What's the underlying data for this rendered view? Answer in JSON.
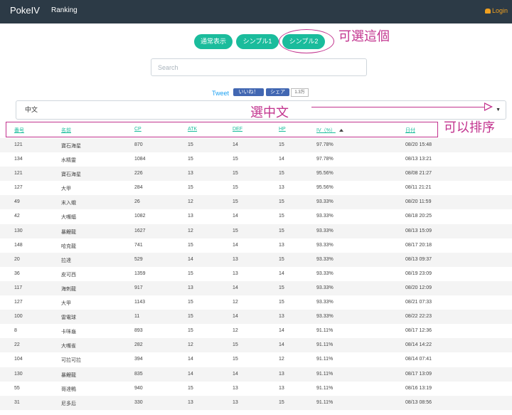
{
  "navbar": {
    "brand": "PokeIV",
    "ranking": "Ranking",
    "login": "Login"
  },
  "tabs": [
    "通常表示",
    "シンプル1",
    "シンプル2"
  ],
  "annotations": {
    "select_tab": "可選這個",
    "select_chinese": "選中文",
    "sortable": "可以排序"
  },
  "search": {
    "placeholder": "Search"
  },
  "social": {
    "tweet": "Tweet",
    "like": "いいね！",
    "share": "シェア",
    "count": "1.3万"
  },
  "language": {
    "selected": "中文"
  },
  "table": {
    "headers": [
      "番号",
      "名前",
      "CP",
      "ATK",
      "DEF",
      "HP",
      "IV（%）",
      "日付"
    ],
    "sorted_column": "IV（%）",
    "rows": [
      [
        "121",
        "寶石海星",
        "870",
        "15",
        "14",
        "15",
        "97.78%",
        "08/20 15:48"
      ],
      [
        "134",
        "水精靈",
        "1084",
        "15",
        "15",
        "14",
        "97.78%",
        "08/13 13:21"
      ],
      [
        "121",
        "寶石海星",
        "226",
        "13",
        "15",
        "15",
        "95.56%",
        "08/08 21:27"
      ],
      [
        "127",
        "大甲",
        "284",
        "15",
        "15",
        "13",
        "95.56%",
        "08/11 21:21"
      ],
      [
        "49",
        "末入蛾",
        "26",
        "12",
        "15",
        "15",
        "93.33%",
        "08/20 11:59"
      ],
      [
        "42",
        "大嘴蝠",
        "1082",
        "13",
        "14",
        "15",
        "93.33%",
        "08/18 20:25"
      ],
      [
        "130",
        "暴鯉龍",
        "1627",
        "12",
        "15",
        "15",
        "93.33%",
        "08/13 15:09"
      ],
      [
        "148",
        "哈克龍",
        "741",
        "15",
        "14",
        "13",
        "93.33%",
        "08/17 20:18"
      ],
      [
        "20",
        "拉達",
        "529",
        "14",
        "13",
        "15",
        "93.33%",
        "08/13 09:37"
      ],
      [
        "36",
        "皮可西",
        "1359",
        "15",
        "13",
        "14",
        "93.33%",
        "08/19 23:09"
      ],
      [
        "117",
        "海刺龍",
        "917",
        "13",
        "14",
        "15",
        "93.33%",
        "08/20 12:09"
      ],
      [
        "127",
        "大甲",
        "1143",
        "15",
        "12",
        "15",
        "93.33%",
        "08/21 07:33"
      ],
      [
        "100",
        "雷電球",
        "11",
        "15",
        "14",
        "13",
        "93.33%",
        "08/22 22:23"
      ],
      [
        "8",
        "卡咪龜",
        "893",
        "15",
        "12",
        "14",
        "91.11%",
        "08/17 12:36"
      ],
      [
        "22",
        "大嘴雀",
        "282",
        "12",
        "15",
        "14",
        "91.11%",
        "08/14 14:22"
      ],
      [
        "104",
        "可拉可拉",
        "394",
        "14",
        "15",
        "12",
        "91.11%",
        "08/14 07:41"
      ],
      [
        "130",
        "暴鯉龍",
        "835",
        "14",
        "14",
        "13",
        "91.11%",
        "08/17 13:09"
      ],
      [
        "55",
        "哥達鴨",
        "940",
        "15",
        "13",
        "13",
        "91.11%",
        "08/16 13:19"
      ],
      [
        "31",
        "尼多后",
        "330",
        "13",
        "13",
        "15",
        "91.11%",
        "08/13 08:56"
      ]
    ]
  },
  "colors": {
    "navbar": "#2c3a46",
    "accent": "#1abc9c",
    "annotation": "#c2338e",
    "login": "#f0a020"
  }
}
